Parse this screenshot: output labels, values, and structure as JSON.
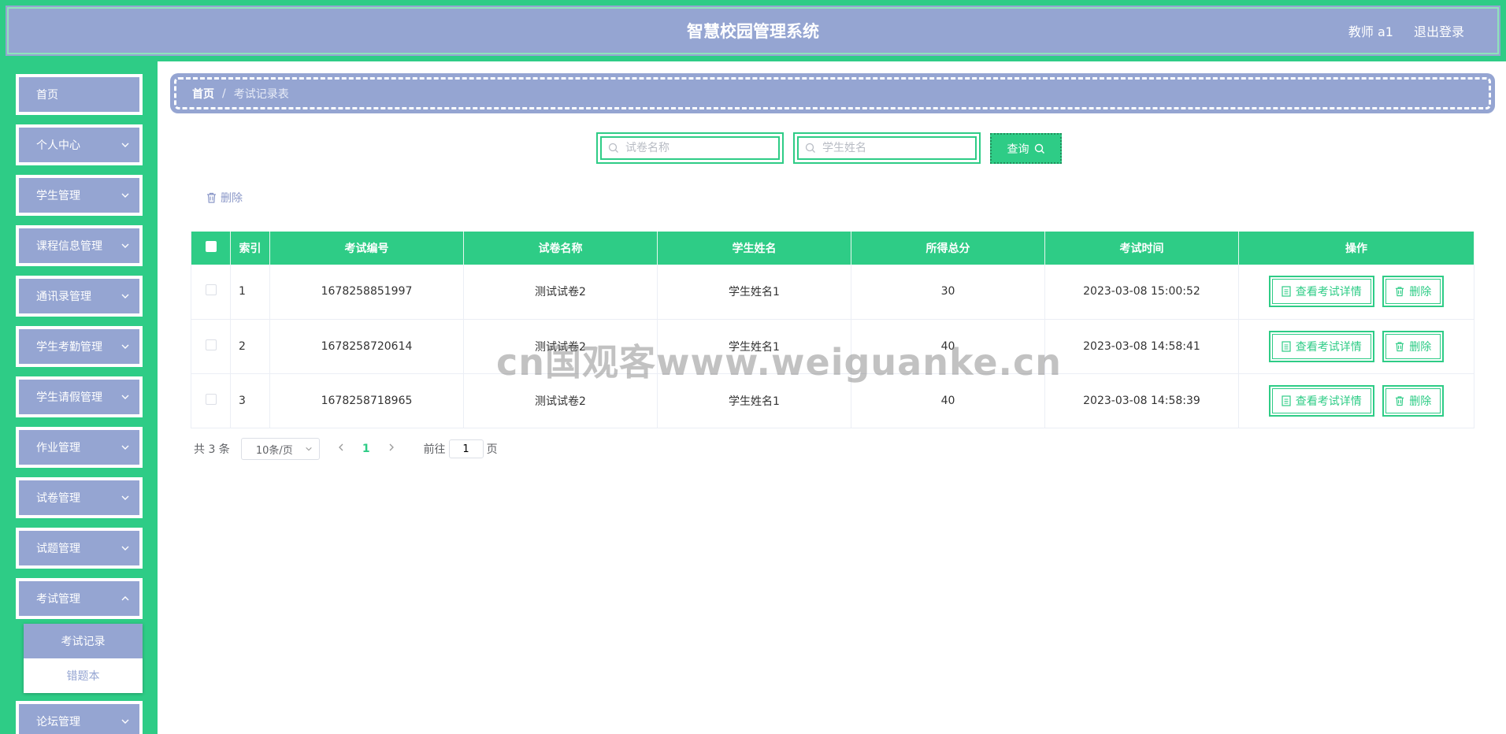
{
  "header": {
    "title": "智慧校园管理系统",
    "user": "教师 a1",
    "logout": "退出登录"
  },
  "sidebar": {
    "items": [
      {
        "label": "首页",
        "has_children": false
      },
      {
        "label": "个人中心",
        "has_children": true
      },
      {
        "label": "学生管理",
        "has_children": true
      },
      {
        "label": "课程信息管理",
        "has_children": true
      },
      {
        "label": "通讯录管理",
        "has_children": true
      },
      {
        "label": "学生考勤管理",
        "has_children": true
      },
      {
        "label": "学生请假管理",
        "has_children": true
      },
      {
        "label": "作业管理",
        "has_children": true
      },
      {
        "label": "试卷管理",
        "has_children": true
      },
      {
        "label": "试题管理",
        "has_children": true
      },
      {
        "label": "考试管理",
        "has_children": true
      },
      {
        "label": "论坛管理",
        "has_children": true
      }
    ],
    "submenu": [
      {
        "label": "考试记录",
        "active": true
      },
      {
        "label": "错题本",
        "active": false
      }
    ]
  },
  "breadcrumb": {
    "home": "首页",
    "separator": "/",
    "current": "考试记录表"
  },
  "search": {
    "paper_placeholder": "试卷名称",
    "student_placeholder": "学生姓名",
    "query_label": "查询"
  },
  "toolbar": {
    "delete_label": "删除"
  },
  "table": {
    "headers": [
      "索引",
      "考试编号",
      "试卷名称",
      "学生姓名",
      "所得总分",
      "考试时间",
      "操作"
    ],
    "rows": [
      {
        "index": "1",
        "exam_no": "1678258851997",
        "paper": "测试试卷2",
        "student": "学生姓名1",
        "score": "30",
        "time": "2023-03-08 15:00:52"
      },
      {
        "index": "2",
        "exam_no": "1678258720614",
        "paper": "测试试卷2",
        "student": "学生姓名1",
        "score": "40",
        "time": "2023-03-08 14:58:41"
      },
      {
        "index": "3",
        "exam_no": "1678258718965",
        "paper": "测试试卷2",
        "student": "学生姓名1",
        "score": "40",
        "time": "2023-03-08 14:58:39"
      }
    ],
    "row_actions": {
      "detail": "查看考试详情",
      "delete": "删除"
    }
  },
  "pagination": {
    "total_text": "共 3 条",
    "page_size": "10条/页",
    "current_page": "1",
    "goto_prefix": "前往",
    "goto_value": "1",
    "goto_suffix": "页"
  },
  "watermark": "cn国观客www.weiguanke.cn",
  "colors": {
    "primary": "#2ecc86",
    "secondary": "#95a5d2"
  }
}
